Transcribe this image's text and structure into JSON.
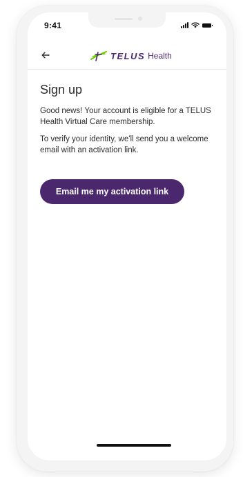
{
  "status_bar": {
    "time": "9:41",
    "icons": [
      "cellular-signal-icon",
      "wifi-icon",
      "battery-icon"
    ]
  },
  "nav": {
    "back_icon": "back-arrow-icon",
    "logo": {
      "brand": "TELUS",
      "product": "Health"
    }
  },
  "main": {
    "title": "Sign up",
    "paragraphs": [
      "Good news! Your account is eligible for a TELUS Health Virtual Care membership.",
      "To verify your identity, we'll send you a welcome email with an activation link."
    ],
    "cta_label": "Email me my activation link"
  },
  "colors": {
    "brand_purple": "#4b286d",
    "brand_green": "#66cc00",
    "text": "#2a2c2e",
    "background": "#ffffff"
  }
}
